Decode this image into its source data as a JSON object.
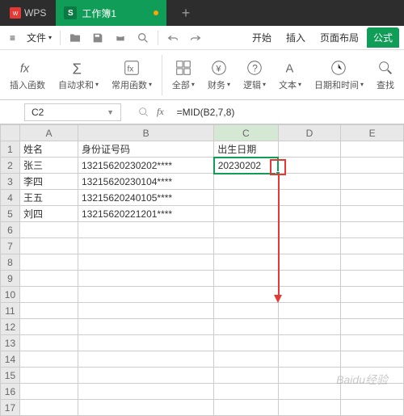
{
  "titlebar": {
    "app_name": "WPS",
    "tab_title": "工作簿1",
    "plus": "+"
  },
  "menubar": {
    "hamburger": "≡",
    "file_label": "文件",
    "arrow": "▾"
  },
  "ribbon": {
    "tabs": {
      "start": "开始",
      "insert": "插入",
      "layout": "页面布局",
      "formula": "公式"
    }
  },
  "toolbar": {
    "insert_fn": "插入函数",
    "autosum": "自动求和",
    "common": "常用函数",
    "all": "全部",
    "financial": "财务",
    "logical": "逻辑",
    "text": "文本",
    "datetime": "日期和时间",
    "lookup": "查找"
  },
  "namebox": {
    "value": "C2"
  },
  "formula": {
    "fx": "fx",
    "value": "=MID(B2,7,8)"
  },
  "sheet": {
    "columns": [
      "A",
      "B",
      "C",
      "D",
      "E"
    ],
    "headers": {
      "a": "姓名",
      "b": "身份证号码",
      "c": "出生日期"
    },
    "rows": [
      {
        "n": "1",
        "a": "姓名",
        "b": "身份证号码",
        "c": "出生日期"
      },
      {
        "n": "2",
        "a": "张三",
        "b": "13215620230202****",
        "c": "20230202"
      },
      {
        "n": "3",
        "a": "李四",
        "b": "13215620230104****",
        "c": ""
      },
      {
        "n": "4",
        "a": "王五",
        "b": "13215620240105****",
        "c": ""
      },
      {
        "n": "5",
        "a": "刘四",
        "b": "13215620221201****",
        "c": ""
      },
      {
        "n": "6"
      },
      {
        "n": "7"
      },
      {
        "n": "8"
      },
      {
        "n": "9"
      },
      {
        "n": "10"
      },
      {
        "n": "11"
      },
      {
        "n": "12"
      },
      {
        "n": "13"
      },
      {
        "n": "14"
      },
      {
        "n": "15"
      },
      {
        "n": "16"
      },
      {
        "n": "17"
      }
    ]
  },
  "watermark": "Baidu经验"
}
